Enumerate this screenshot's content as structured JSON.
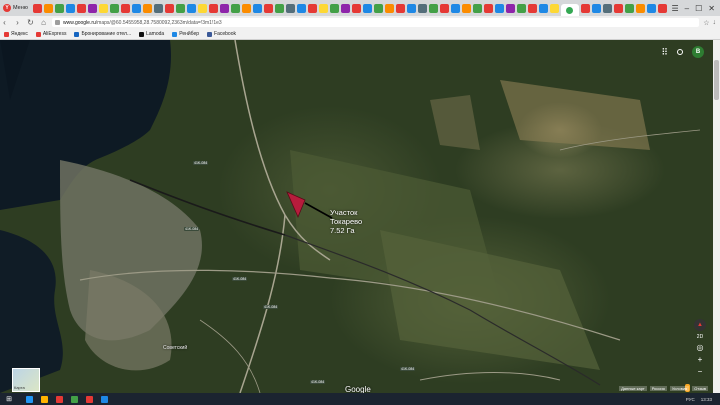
{
  "browser": {
    "menu_label": "Меню",
    "tab_colors": [
      "#e53935",
      "#fb8c00",
      "#43a047",
      "#1e88e5",
      "#e53935",
      "#8e24aa",
      "#fdd835",
      "#43a047",
      "#e53935",
      "#1e88e5",
      "#fb8c00",
      "#546e7a",
      "#e53935",
      "#43a047",
      "#1e88e5",
      "#fdd835",
      "#e53935",
      "#8e24aa",
      "#43a047",
      "#fb8c00",
      "#1e88e5",
      "#e53935",
      "#43a047",
      "#546e7a",
      "#1e88e5",
      "#e53935",
      "#fdd835",
      "#43a047",
      "#8e24aa",
      "#e53935",
      "#1e88e5",
      "#43a047",
      "#fb8c00",
      "#e53935",
      "#1e88e5",
      "#546e7a",
      "#43a047",
      "#e53935",
      "#1e88e5",
      "#fb8c00",
      "#43a047",
      "#e53935",
      "#1e88e5",
      "#8e24aa",
      "#43a047",
      "#e53935",
      "#1e88e5",
      "#fdd835",
      "#43a047",
      "#e53935",
      "#1e88e5",
      "#546e7a",
      "#e53935",
      "#43a047",
      "#fb8c00",
      "#1e88e5",
      "#e53935"
    ],
    "window_controls": [
      "☰",
      "–",
      "☐",
      "✕"
    ]
  },
  "addressbar": {
    "url_host": "www.google.ru",
    "url_path": "/maps/@60.5455958,28.7580092,2363m/data=!3m1!1e3"
  },
  "bookmarks": [
    {
      "label": "Яндекс",
      "color": "#e53935"
    },
    {
      "label": "AliExpress",
      "color": "#e53935"
    },
    {
      "label": "Бронирование отел...",
      "color": "#1565c0"
    },
    {
      "label": "Lamoda",
      "color": "#111111"
    },
    {
      "label": "Ренйбер",
      "color": "#1e88e5"
    },
    {
      "label": "Facebook",
      "color": "#3b5998"
    }
  ],
  "map": {
    "marker_label_line1": "Участок",
    "marker_label_line2": "Токарево",
    "marker_label_line3": "7.52 Га",
    "marker_color": "#b71c3c",
    "place_labels": [
      "Советский"
    ],
    "road_badges": [
      "41K-084",
      "41K-084",
      "41K-084",
      "41K-084",
      "41K-084",
      "41K-084"
    ],
    "avatar_letter": "B",
    "zoom_level": "2D",
    "satellite_label": "Карта",
    "google_logo": "Google",
    "footer_items": [
      "Данные карт",
      "Россия",
      "Условия",
      "Отзыв"
    ]
  },
  "taskbar": {
    "start_icon": "⊞",
    "app_colors": [
      "#2196f3",
      "#ffb300",
      "#e53935",
      "#43a047",
      "#e53935",
      "#1e88e5"
    ],
    "tray_lang": "РУС",
    "tray_time": "13:33"
  }
}
